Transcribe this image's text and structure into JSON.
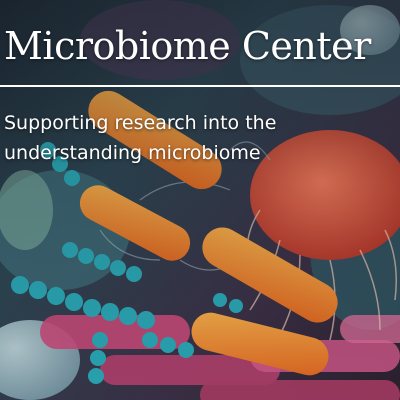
{
  "hero": {
    "title": "Microbiome Center",
    "subtitle": "Supporting research into the understanding microbiome",
    "image_icon": "bacteria-illustration",
    "colors": {
      "text": "#ffffff",
      "rule": "#ffffff",
      "bacteria_orange": "#f08a2c",
      "microbe_red": "#d9553f",
      "bead_teal": "#2aa7b5",
      "rod_pink": "#c94a7a"
    }
  }
}
